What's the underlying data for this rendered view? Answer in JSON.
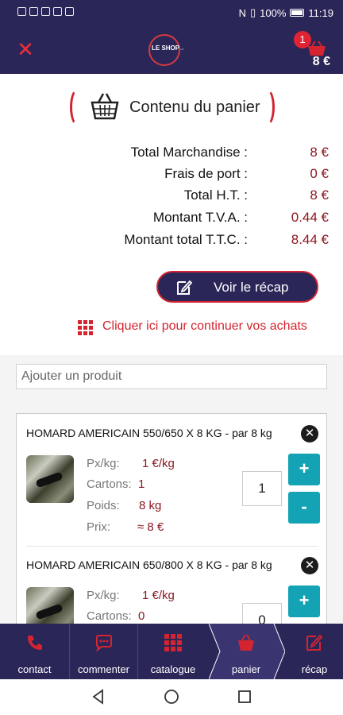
{
  "status_bar": {
    "battery": "100%",
    "time": "11:19"
  },
  "header": {
    "logo_text": "LE SHOP",
    "cart_count": "1",
    "cart_total": "8 €"
  },
  "summary": {
    "title": "Contenu du panier",
    "rows": [
      {
        "label": "Total Marchandise :",
        "value": "8 €"
      },
      {
        "label": "Frais de port :",
        "value": "0 €"
      },
      {
        "label": "Total H.T. :",
        "value": "8 €"
      },
      {
        "label": "Montant T.V.A. :",
        "value": "0.44 €"
      },
      {
        "label": "Montant total T.T.C. :",
        "value": "8.44 €"
      }
    ],
    "recap_button": "Voir le récap",
    "continue_link": "Cliquer ici pour continuer vos achats"
  },
  "search": {
    "placeholder": "Ajouter un produit"
  },
  "products": [
    {
      "name": "HOMARD AMERICAIN 550/650 X 8 KG - par 8 kg",
      "price_label": "Px/kg:",
      "price": "1 €/kg",
      "cartons_label": "Cartons:",
      "cartons": "1",
      "poids_label": "Poids:",
      "poids": "8 kg",
      "prix_label": "Prix:",
      "prix": "≈ 8 €",
      "quantity": "1"
    },
    {
      "name": "HOMARD AMERICAIN 650/800 X 8 KG - par 8 kg",
      "price_label": "Px/kg:",
      "price": "1 €/kg",
      "cartons_label": "Cartons:",
      "cartons": "0",
      "quantity": "0"
    }
  ],
  "nav": [
    {
      "label": "contact",
      "icon": "phone-icon"
    },
    {
      "label": "commenter",
      "icon": "chat-icon"
    },
    {
      "label": "catalogue",
      "icon": "grid-icon"
    },
    {
      "label": "panier",
      "icon": "basket-icon"
    },
    {
      "label": "récap",
      "icon": "edit-icon"
    }
  ],
  "colors": {
    "primary": "#2b2658",
    "accent": "#d4242f",
    "teal": "#14a3b4",
    "value": "#8b1822"
  }
}
